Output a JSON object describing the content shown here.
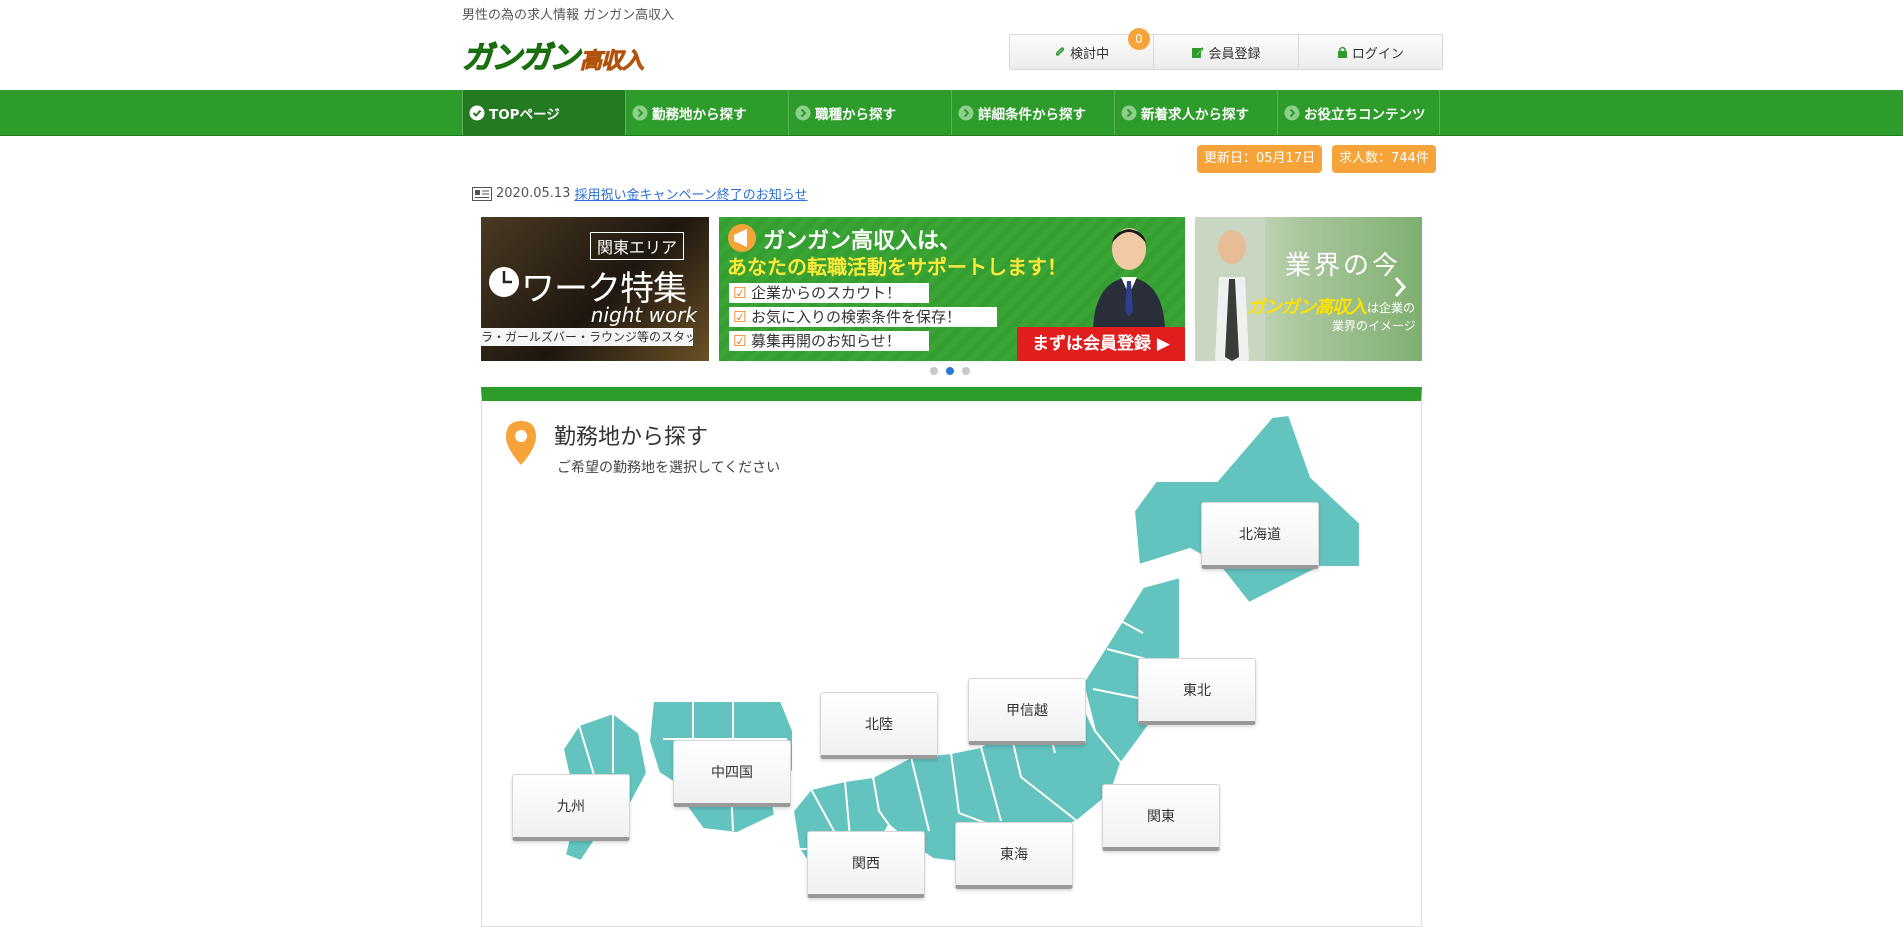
{
  "header": {
    "tagline": "男性の為の求人情報 ガンガン高収入",
    "logo_text_green": "ガンガン",
    "logo_text_orange": "高収入"
  },
  "userbox": {
    "consider_label": "検討中",
    "consider_count": "0",
    "register_label": "会員登録",
    "login_label": "ログイン"
  },
  "nav": {
    "items": [
      {
        "label": "TOPページ"
      },
      {
        "label": "勤務地から探す"
      },
      {
        "label": "職種から探す"
      },
      {
        "label": "詳細条件から探す"
      },
      {
        "label": "新着求人から探す"
      },
      {
        "label": "お役立ちコンテンツ"
      }
    ]
  },
  "stats": {
    "updated": "更新日：05月17日",
    "count": "求人数：744件"
  },
  "news": {
    "date": "2020.05.13",
    "link_text": "採用祝い金キャンペーン終了のお知らせ"
  },
  "banners": {
    "night": {
      "area": "関東エリア",
      "title": "ワーク特集",
      "subtitle": "night work",
      "staff": "ラ・ガールズバー・ラウンジ等のスタッフ"
    },
    "support": {
      "headline1": "ガンガン高収入は、",
      "headline2": "あなたの転職活動をサポートします！",
      "point1": "企業からのスカウト！",
      "point2": "お気に入りの検索条件を保存！",
      "point3": "募集再開のお知らせ！",
      "cta": "まずは会員登録"
    },
    "industry": {
      "title": "業界の今",
      "line1": "ガンガン高収入",
      "line2": "は企業の",
      "line3": "業界のイメージ"
    }
  },
  "area": {
    "title": "勤務地から探す",
    "subtitle": "ご希望の勤務地を選択してください",
    "regions": {
      "hokkaido": "北海道",
      "tohoku": "東北",
      "koshinetsu": "甲信越",
      "hokuriku": "北陸",
      "chushikoku": "中四国",
      "kyushu": "九州",
      "kanto": "関東",
      "tokai": "東海",
      "kansai": "関西"
    }
  },
  "colors": {
    "brand_green": "#2e9c2b",
    "accent_orange": "#f6a43a",
    "map_teal": "#63c4bf",
    "link_blue": "#2a6fd6"
  }
}
